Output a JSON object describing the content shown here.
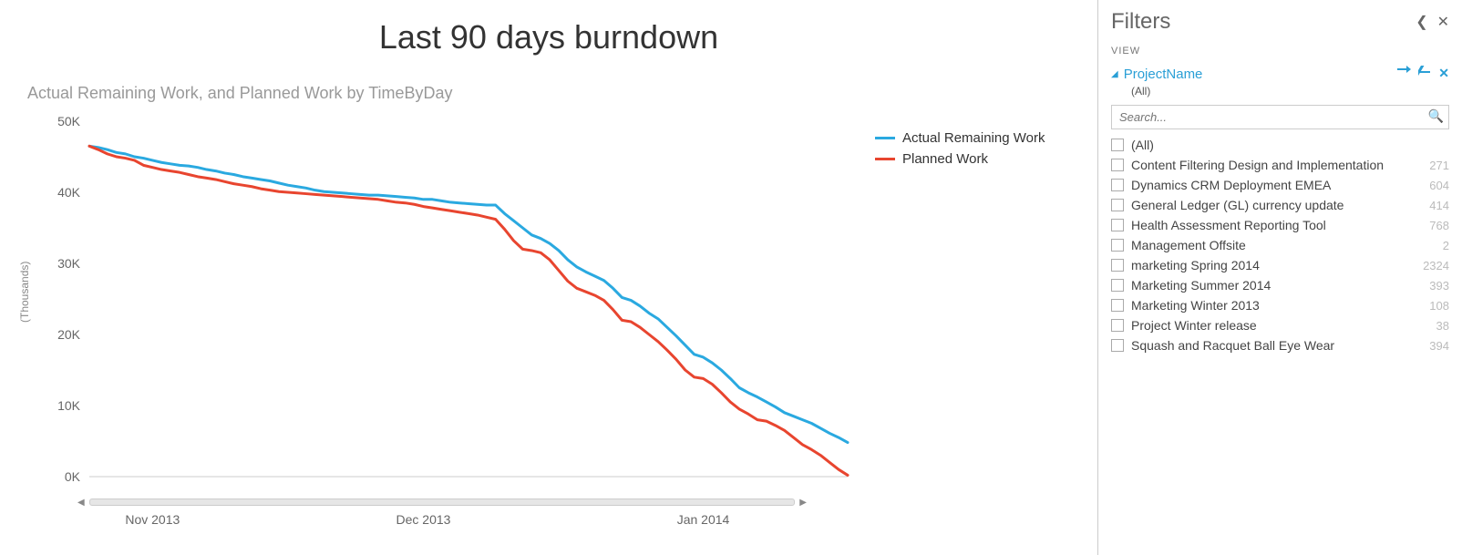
{
  "chart_data": {
    "type": "line",
    "title": "Last 90 days burndown",
    "subtitle": "Actual Remaining Work, and Planned Work by TimeByDay",
    "yaxis_title": "(Thousands)",
    "ylim": [
      0,
      50000
    ],
    "yticks": [
      "0K",
      "10K",
      "20K",
      "30K",
      "40K",
      "50K"
    ],
    "x_category_labels": [
      "Nov 2013",
      "Dec 2013",
      "Jan 2014"
    ],
    "x_category_positions": [
      7,
      37,
      68
    ],
    "x": [
      0,
      1,
      2,
      3,
      4,
      5,
      6,
      7,
      8,
      9,
      10,
      11,
      12,
      13,
      14,
      15,
      16,
      17,
      18,
      19,
      20,
      21,
      22,
      23,
      24,
      25,
      26,
      27,
      28,
      29,
      30,
      31,
      32,
      33,
      34,
      35,
      36,
      37,
      38,
      39,
      40,
      41,
      42,
      43,
      44,
      45,
      46,
      47,
      48,
      49,
      50,
      51,
      52,
      53,
      54,
      55,
      56,
      57,
      58,
      59,
      60,
      61,
      62,
      63,
      64,
      65,
      66,
      67,
      68,
      69,
      70,
      71,
      72,
      73,
      74,
      75,
      76,
      77,
      78,
      79,
      80,
      81,
      82,
      83,
      84
    ],
    "series": [
      {
        "name": "Actual Remaining Work",
        "color": "#2aa9e0",
        "values": [
          46500,
          46300,
          46000,
          45600,
          45400,
          45000,
          44800,
          44500,
          44200,
          44000,
          43800,
          43700,
          43500,
          43200,
          43000,
          42700,
          42500,
          42200,
          42000,
          41800,
          41600,
          41300,
          41000,
          40800,
          40600,
          40300,
          40100,
          40000,
          39900,
          39800,
          39700,
          39600,
          39600,
          39500,
          39400,
          39300,
          39200,
          39000,
          39000,
          38800,
          38600,
          38500,
          38400,
          38300,
          38200,
          38200,
          37000,
          36000,
          35000,
          34000,
          33500,
          32800,
          31800,
          30500,
          29500,
          28800,
          28200,
          27600,
          26500,
          25200,
          24800,
          24000,
          23000,
          22200,
          21000,
          19800,
          18500,
          17200,
          16800,
          16000,
          15000,
          13800,
          12500,
          11800,
          11200,
          10500,
          9800,
          9000,
          8500,
          8000,
          7500,
          6800,
          6100,
          5500,
          4800
        ]
      },
      {
        "name": "Planned Work",
        "color": "#e8452f",
        "values": [
          46500,
          46000,
          45400,
          45000,
          44800,
          44500,
          43800,
          43500,
          43200,
          43000,
          42800,
          42500,
          42200,
          42000,
          41800,
          41500,
          41200,
          41000,
          40800,
          40500,
          40300,
          40100,
          40000,
          39900,
          39800,
          39700,
          39600,
          39500,
          39400,
          39300,
          39200,
          39100,
          39000,
          38800,
          38600,
          38500,
          38300,
          38000,
          37800,
          37600,
          37400,
          37200,
          37000,
          36800,
          36500,
          36200,
          34800,
          33200,
          32000,
          31800,
          31500,
          30500,
          29000,
          27500,
          26500,
          26000,
          25500,
          24800,
          23500,
          22000,
          21800,
          21000,
          20000,
          19000,
          17800,
          16500,
          15000,
          14000,
          13800,
          13000,
          11800,
          10500,
          9500,
          8800,
          8000,
          7800,
          7200,
          6500,
          5500,
          4500,
          3800,
          3000,
          2000,
          1000,
          200
        ]
      }
    ]
  },
  "legend": {
    "items": [
      "Actual Remaining Work",
      "Planned Work"
    ]
  },
  "filters": {
    "panel_title": "Filters",
    "section": "VIEW",
    "field_name": "ProjectName",
    "all_label": "(All)",
    "search_placeholder": "Search...",
    "items": [
      {
        "label": "(All)",
        "count": ""
      },
      {
        "label": "Content Filtering Design and Implementation",
        "count": "271"
      },
      {
        "label": "Dynamics CRM Deployment EMEA",
        "count": "604"
      },
      {
        "label": "General Ledger (GL) currency update",
        "count": "414"
      },
      {
        "label": "Health Assessment Reporting Tool",
        "count": "768"
      },
      {
        "label": "Management Offsite",
        "count": "2"
      },
      {
        "label": "marketing Spring 2014",
        "count": "2324"
      },
      {
        "label": "Marketing Summer 2014",
        "count": "393"
      },
      {
        "label": "Marketing Winter 2013",
        "count": "108"
      },
      {
        "label": "Project Winter release",
        "count": "38"
      },
      {
        "label": "Squash and Racquet Ball Eye Wear",
        "count": "394"
      }
    ]
  }
}
